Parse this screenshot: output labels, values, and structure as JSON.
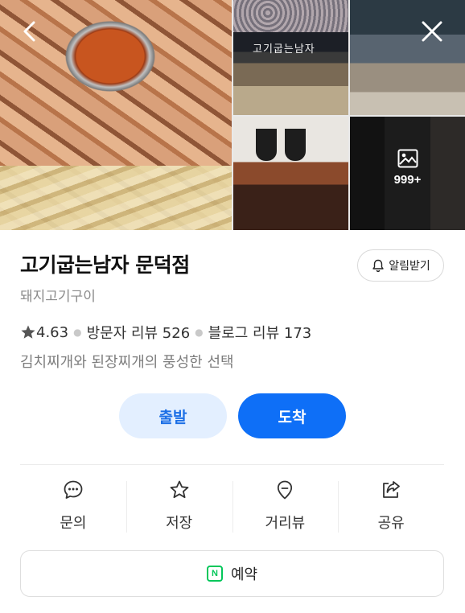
{
  "gallery": {
    "more_count": "999+",
    "store_sign": "고기굽는남자"
  },
  "store": {
    "name": "고기굽는남자 문덕점",
    "category": "돼지고기구이",
    "rating": "4.63",
    "visitor_reviews": "방문자 리뷰 526",
    "blog_reviews": "블로그 리뷰 173",
    "description": "김치찌개와 된장찌개의 풍성한 선택"
  },
  "notify_label": "알림받기",
  "route": {
    "depart": "출발",
    "arrive": "도착"
  },
  "actions": [
    {
      "label": "문의",
      "icon": "chat-bubble-icon"
    },
    {
      "label": "저장",
      "icon": "star-outline-icon"
    },
    {
      "label": "거리뷰",
      "icon": "location-pin-icon"
    },
    {
      "label": "공유",
      "icon": "share-icon"
    }
  ],
  "reserve": {
    "label": "예약",
    "badge": "N",
    "icon": "naver-booking-icon"
  },
  "colors": {
    "primary": "#0e6ff7",
    "primary_light": "#e3efff",
    "naver_green": "#03c75a"
  }
}
